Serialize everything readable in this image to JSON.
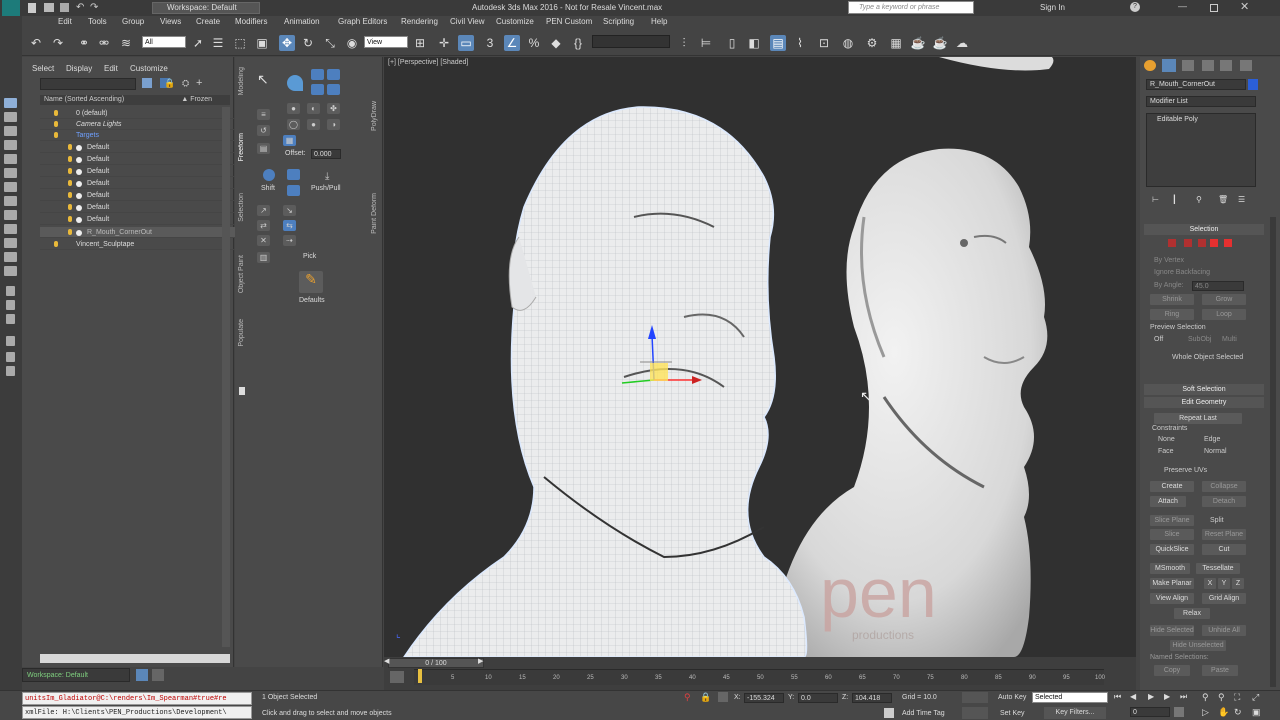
{
  "title": {
    "workspace_label": "Workspace: Default",
    "app_title": "Autodesk 3ds Max 2016 - Not for Resale   Vincent.max",
    "search_placeholder": "Type a keyword or phrase",
    "sign_in": "Sign In"
  },
  "menu": [
    "Edit",
    "Tools",
    "Group",
    "Views",
    "Create",
    "Modifiers",
    "Animation",
    "Graph Editors",
    "Rendering",
    "Civil View",
    "Customize",
    "PEN Custom",
    "Scripting",
    "Help"
  ],
  "toolbar": {
    "selection_filter": "All",
    "ref_coord": "View",
    "named_selection": ""
  },
  "scene_explorer": {
    "tabs": [
      "Select",
      "Display",
      "Edit",
      "Customize"
    ],
    "header": "Name (Sorted Ascending)",
    "frozen_header": "▲ Frozen",
    "items": [
      {
        "label": "0 (default)"
      },
      {
        "label": "Camera Lights"
      },
      {
        "label": "Targets"
      },
      {
        "label": "Default"
      },
      {
        "label": "Default"
      },
      {
        "label": "Default"
      },
      {
        "label": "Default"
      },
      {
        "label": "Default"
      },
      {
        "label": "Default"
      },
      {
        "label": "Default"
      },
      {
        "label": "R_Mouth_CornerOut"
      },
      {
        "label": "Vincent_Sculptape"
      }
    ],
    "workspace_bottom": "Workspace: Default"
  },
  "ribbon": {
    "tabs": [
      "Modeling",
      "Freeform",
      "Selection",
      "Object Paint",
      "Populate"
    ],
    "side_tabs": [
      "PolyDraw",
      "Paint Deform"
    ],
    "offset_label": "Offset:",
    "offset_value": "0.000",
    "shift_label": "Shift",
    "push_pull_label": "Push/Pull",
    "pick_label": "Pick",
    "defaults_label": "Defaults"
  },
  "viewport": {
    "label": "[+] [Perspective] [Shaded]",
    "watermark": "pen",
    "watermark_sub": "productions"
  },
  "command_panel": {
    "object_name": "R_Mouth_CornerOut",
    "modifier_list": "Modifier List",
    "stack_item": "Editable Poly",
    "sections": {
      "selection": "Selection",
      "soft_selection": "Soft Selection",
      "edit_geometry": "Edit Geometry"
    },
    "by_vertex": "By Vertex",
    "ignore_backfacing": "Ignore Backfacing",
    "by_angle": "By Angle:",
    "by_angle_value": "45.0",
    "shrink": "Shrink",
    "grow": "Grow",
    "ring": "Ring",
    "loop": "Loop",
    "preview_selection": "Preview Selection",
    "preview_opts": [
      "Off",
      "SubObj",
      "Multi"
    ],
    "whole_object": "Whole Object Selected",
    "repeat_last": "Repeat Last",
    "constraints": "Constraints",
    "constraint_opts": [
      "None",
      "Edge",
      "Face",
      "Normal"
    ],
    "preserve_uvs": "Preserve UVs",
    "create": "Create",
    "collapse": "Collapse",
    "attach": "Attach",
    "detach": "Detach",
    "slice_plane": "Slice Plane",
    "split": "Split",
    "slice": "Slice",
    "reset_plane": "Reset Plane",
    "quickslice": "QuickSlice",
    "cut": "Cut",
    "msmooth": "MSmooth",
    "tessellate": "Tessellate",
    "make_planar": "Make Planar",
    "x": "X",
    "y": "Y",
    "z": "Z",
    "view_align": "View Align",
    "grid_align": "Grid Align",
    "relax": "Relax",
    "hide_selected": "Hide Selected",
    "unhide_all": "Unhide All",
    "hide_unselected": "Hide Unselected",
    "named_selections": "Named Selections:",
    "copy": "Copy",
    "paste": "Paste"
  },
  "timeline": {
    "frame": "0 / 100",
    "ticks": [
      "5",
      "10",
      "15",
      "20",
      "25",
      "30",
      "35",
      "40",
      "45",
      "50",
      "55",
      "60",
      "65",
      "70",
      "75",
      "80",
      "85",
      "90",
      "95",
      "100"
    ]
  },
  "status": {
    "script_line_1": "unitsIm_Gladiator@C:\\renders\\Im_Spearman#true#re",
    "script_line_2": "xmlFile: H:\\Clients\\PEN_Productions\\Development\\",
    "objects_selected": "1 Object Selected",
    "prompt": "Click and drag to select and move objects",
    "x_label": "X:",
    "x_value": "-155.324",
    "y_label": "Y:",
    "y_value": "0.0",
    "z_label": "Z:",
    "z_value": "104.418",
    "grid": "Grid = 10.0",
    "add_time_tag": "Add Time Tag",
    "auto_key": "Auto Key",
    "auto_key_mode": "Selected",
    "set_key": "Set Key",
    "key_filters": "Key Filters...",
    "frame_field": "0"
  },
  "colors": {
    "accent": "#5b87b9",
    "background": "#444444",
    "viewport": "#303030",
    "highlight_text": "#6fa0ff"
  }
}
